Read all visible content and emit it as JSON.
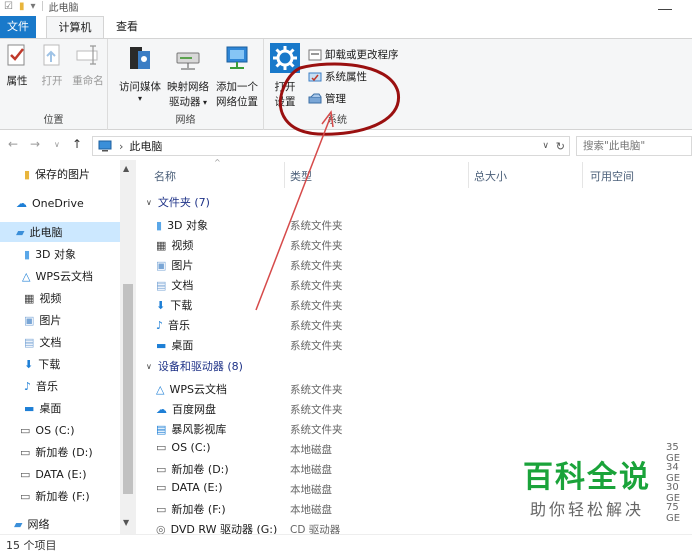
{
  "window": {
    "title": "此电脑"
  },
  "tabs": [
    {
      "label": "文件"
    },
    {
      "label": "计算机"
    },
    {
      "label": "查看"
    }
  ],
  "ribbon": {
    "location": {
      "label": "位置",
      "buttons": [
        {
          "label": "属性"
        },
        {
          "label": "打开"
        },
        {
          "label": "重命名"
        }
      ]
    },
    "network": {
      "label": "网络",
      "buttons": [
        {
          "line1": "访问媒体",
          "line2": ""
        },
        {
          "line1": "映射网络",
          "line2": "驱动器"
        },
        {
          "line1": "添加一个",
          "line2": "网络位置"
        }
      ]
    },
    "system": {
      "label": "系统",
      "settings_line1": "打开",
      "settings_line2": "设置",
      "uninstall": "卸载或更改程序",
      "properties": "系统属性",
      "manage": "管理"
    }
  },
  "address": {
    "path": "此电脑",
    "search_placeholder": "搜索\"此电脑\""
  },
  "nav_pane": [
    {
      "label": "保存的图片",
      "icon": "folder-icon"
    },
    {
      "label": "OneDrive",
      "icon": "cloud-icon"
    },
    {
      "label": "此电脑",
      "icon": "computer-icon",
      "selected": true
    },
    {
      "label": "3D 对象",
      "icon": "folder-icon"
    },
    {
      "label": "WPS云文档",
      "icon": "cloud-icon"
    },
    {
      "label": "视频",
      "icon": "video-icon"
    },
    {
      "label": "图片",
      "icon": "picture-icon"
    },
    {
      "label": "文档",
      "icon": "document-icon"
    },
    {
      "label": "下载",
      "icon": "download-icon"
    },
    {
      "label": "音乐",
      "icon": "music-icon"
    },
    {
      "label": "桌面",
      "icon": "folder-icon"
    },
    {
      "label": "OS (C:)",
      "icon": "drive-icon"
    },
    {
      "label": "新加卷 (D:)",
      "icon": "drive-icon"
    },
    {
      "label": "DATA (E:)",
      "icon": "drive-icon"
    },
    {
      "label": "新加卷 (F:)",
      "icon": "drive-icon"
    },
    {
      "label": "网络",
      "icon": "network-icon"
    }
  ],
  "columns": {
    "name": "名称",
    "type": "类型",
    "size": "总大小",
    "free": "可用空间"
  },
  "groups": {
    "folders": "文件夹 (7)",
    "devices": "设备和驱动器 (8)"
  },
  "folders": [
    {
      "name": "3D 对象",
      "type": "系统文件夹",
      "icon": "folder-icon"
    },
    {
      "name": "视频",
      "type": "系统文件夹",
      "icon": "video-icon"
    },
    {
      "name": "图片",
      "type": "系统文件夹",
      "icon": "picture-icon"
    },
    {
      "name": "文档",
      "type": "系统文件夹",
      "icon": "document-icon"
    },
    {
      "name": "下载",
      "type": "系统文件夹",
      "icon": "download-icon"
    },
    {
      "name": "音乐",
      "type": "系统文件夹",
      "icon": "music-icon"
    },
    {
      "name": "桌面",
      "type": "系统文件夹",
      "icon": "folder-icon"
    }
  ],
  "devices": [
    {
      "name": "WPS云文档",
      "type": "系统文件夹",
      "size": "",
      "icon": "cloud-icon"
    },
    {
      "name": "百度网盘",
      "type": "系统文件夹",
      "size": "",
      "icon": "cloud-icon"
    },
    {
      "name": "暴风影视库",
      "type": "系统文件夹",
      "size": "",
      "icon": "video-icon"
    },
    {
      "name": "OS (C:)",
      "type": "本地磁盘",
      "size": "35 GE",
      "icon": "drive-icon"
    },
    {
      "name": "新加卷 (D:)",
      "type": "本地磁盘",
      "size": "34 GE",
      "icon": "drive-icon"
    },
    {
      "name": "DATA (E:)",
      "type": "本地磁盘",
      "size": "30 GE",
      "icon": "drive-icon"
    },
    {
      "name": "新加卷 (F:)",
      "type": "本地磁盘",
      "size": "75 GE",
      "icon": "drive-icon"
    },
    {
      "name": "DVD RW 驱动器 (G:)",
      "type": "CD 驱动器",
      "size": "",
      "icon": "dvd-icon"
    }
  ],
  "status": {
    "count": "15 个项目"
  },
  "watermark": {
    "title": "百科全说",
    "subtitle": "助你轻松解决"
  },
  "colors": {
    "accent": "#1979ca",
    "selection": "#cce8ff",
    "annotation": "#9a1010",
    "watermark": "#1aa33a"
  }
}
